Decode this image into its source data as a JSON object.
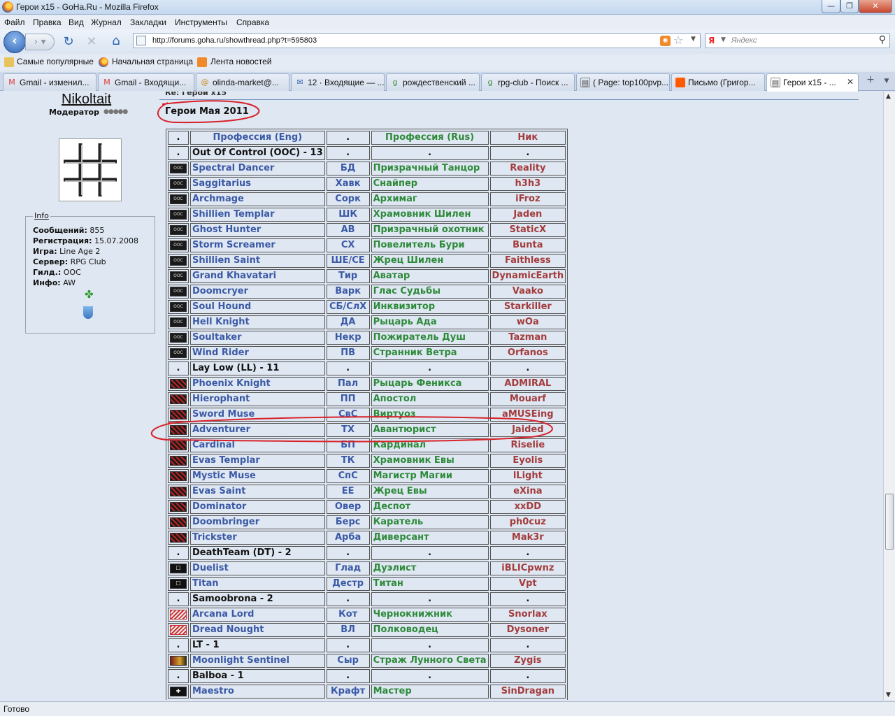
{
  "window": {
    "title": "Герои x15 - GoHa.Ru - Mozilla Firefox",
    "min": "—",
    "max": "❐",
    "close": "✕"
  },
  "menu": [
    "Файл",
    "Правка",
    "Вид",
    "Журнал",
    "Закладки",
    "Инструменты",
    "Справка"
  ],
  "nav": {
    "url": "http://forums.goha.ru/showthread.php?t=595803",
    "search_placeholder": "Яндекс"
  },
  "bookmarks": [
    "Самые популярные",
    "Начальная страница",
    "Лента новостей"
  ],
  "tabs": [
    {
      "label": "Gmail - изменил...",
      "icon": "gmail-icon"
    },
    {
      "label": "Gmail - Входящи...",
      "icon": "gmail-icon"
    },
    {
      "label": "olinda-market@...",
      "icon": "mail-icon"
    },
    {
      "label": "12 · Входящие — ...",
      "icon": "mail-icon"
    },
    {
      "label": "рождественский ...",
      "icon": "google-icon"
    },
    {
      "label": "rpg-club - Поиск ...",
      "icon": "google-icon"
    },
    {
      "label": "( Page: top100pvp...",
      "icon": "page-icon"
    },
    {
      "label": "Письмо (Григор...",
      "icon": "mail-icon"
    },
    {
      "label": "Герои x15 - ...",
      "icon": "page-icon"
    }
  ],
  "sidebar": {
    "username": "Nikoltait",
    "rank": "Модератор",
    "info_title": "Info",
    "info": [
      {
        "k": "Сообщений:",
        "v": "855"
      },
      {
        "k": "Регистрация:",
        "v": "15.07.2008"
      },
      {
        "k": "Игра:",
        "v": "Line Age 2"
      },
      {
        "k": "Сервер:",
        "v": "RPG Club"
      },
      {
        "k": "Гилд.:",
        "v": "OOC"
      },
      {
        "k": "Инфо:",
        "v": "AW"
      }
    ]
  },
  "post": {
    "title_cut": "Re: Герои x15",
    "heading": "Герои Мая 2011"
  },
  "table": {
    "header": {
      "icon": ".",
      "eng": "Профессия (Eng)",
      "short": ".",
      "rus": "Профессия (Rus)",
      "nick": "Ник"
    },
    "rows": [
      {
        "clan": "Out Of Control (OOC) - 13"
      },
      {
        "icon": "ooc",
        "eng": "Spectral Dancer",
        "short": "БД",
        "rus": "Призрачный Танцор",
        "nick": "Reality"
      },
      {
        "icon": "ooc",
        "eng": "Saggitarius",
        "short": "Хавк",
        "rus": "Снайпер",
        "nick": "h3h3"
      },
      {
        "icon": "ooc",
        "eng": "Archmage",
        "short": "Сорк",
        "rus": "Архимаг",
        "nick": "iFroz"
      },
      {
        "icon": "ooc",
        "eng": "Shillien Templar",
        "short": "ШК",
        "rus": "Храмовник Шилен",
        "nick": "Jaden"
      },
      {
        "icon": "ooc",
        "eng": "Ghost Hunter",
        "short": "АВ",
        "rus": "Призрачный охотник",
        "nick": "StaticX"
      },
      {
        "icon": "ooc",
        "eng": "Storm Screamer",
        "short": "СХ",
        "rus": "Повелитель Бури",
        "nick": "Bunta"
      },
      {
        "icon": "ooc",
        "eng": "Shillien Saint",
        "short": "ШЕ/СЕ",
        "rus": "Жрец Шилен",
        "nick": "Faithless"
      },
      {
        "icon": "ooc",
        "eng": "Grand Khavatari",
        "short": "Тир",
        "rus": "Аватар",
        "nick": "DynamicEarth"
      },
      {
        "icon": "ooc",
        "eng": "Doomcryer",
        "short": "Варк",
        "rus": "Глас Судьбы",
        "nick": "Vaako"
      },
      {
        "icon": "ooc",
        "eng": "Soul Hound",
        "short": "СБ/СлХ",
        "rus": "Инквизитор",
        "nick": "Starkiller"
      },
      {
        "icon": "ooc",
        "eng": "Hell Knight",
        "short": "ДА",
        "rus": "Рыцарь Ада",
        "nick": "wOa"
      },
      {
        "icon": "ooc",
        "eng": "Soultaker",
        "short": "Некр",
        "rus": "Пожиратель Душ",
        "nick": "Tazman"
      },
      {
        "icon": "ooc",
        "eng": "Wind Rider",
        "short": "ПВ",
        "rus": "Странник Ветра",
        "nick": "Orfanos"
      },
      {
        "clan": "Lay Low (LL) - 11"
      },
      {
        "icon": "ll",
        "eng": "Phoenix Knight",
        "short": "Пал",
        "rus": "Рыцарь Феникса",
        "nick": "ADMIRAL"
      },
      {
        "icon": "ll",
        "eng": "Hierophant",
        "short": "ПП",
        "rus": "Апостол",
        "nick": "Mouarf"
      },
      {
        "icon": "ll",
        "eng": "Sword Muse",
        "short": "СвС",
        "rus": "Виртуоз",
        "nick": "aMUSEing"
      },
      {
        "icon": "ll",
        "eng": "Adventurer",
        "short": "ТХ",
        "rus": "Авантюрист",
        "nick": "Jaided"
      },
      {
        "icon": "ll",
        "eng": "Cardinal",
        "short": "БП",
        "rus": "Кардинал",
        "nick": "Riselie"
      },
      {
        "icon": "ll",
        "eng": "Evas Templar",
        "short": "ТК",
        "rus": "Храмовник Евы",
        "nick": "Eyolis"
      },
      {
        "icon": "ll",
        "eng": "Mystic Muse",
        "short": "СпС",
        "rus": "Магистр Магии",
        "nick": "lLight"
      },
      {
        "icon": "ll",
        "eng": "Evas Saint",
        "short": "ЕЕ",
        "rus": "Жрец Евы",
        "nick": "eXina"
      },
      {
        "icon": "ll",
        "eng": "Dominator",
        "short": "Овер",
        "rus": "Деспот",
        "nick": "xxDD"
      },
      {
        "icon": "ll",
        "eng": "Doombringer",
        "short": "Берс",
        "rus": "Каратель",
        "nick": "ph0cuz"
      },
      {
        "icon": "ll",
        "eng": "Trickster",
        "short": "Арба",
        "rus": "Диверсант",
        "nick": "Mak3r"
      },
      {
        "clan": "DeathTeam (DT) - 2"
      },
      {
        "icon": "dt",
        "eng": "Duelist",
        "short": "Глад",
        "rus": "Дуэлист",
        "nick": "iBLICpwnz"
      },
      {
        "icon": "dt",
        "eng": "Titan",
        "short": "Дестр",
        "rus": "Титан",
        "nick": "Vpt"
      },
      {
        "clan": "Samoobrona - 2"
      },
      {
        "icon": "sb",
        "eng": "Arcana Lord",
        "short": "Кот",
        "rus": "Чернокнижник",
        "nick": "Snorlax"
      },
      {
        "icon": "sb",
        "eng": "Dread Nought",
        "short": "ВЛ",
        "rus": "Полководец",
        "nick": "Dysoner"
      },
      {
        "clan": "LT - 1"
      },
      {
        "icon": "lt",
        "eng": "Moonlight Sentinel",
        "short": "Сыр",
        "rus": "Страж Лунного Света",
        "nick": "Zygis"
      },
      {
        "clan": "Balboa - 1"
      },
      {
        "icon": "bb",
        "eng": "Maestro",
        "short": "Крафт",
        "rus": "Мастер",
        "nick": "SinDragan"
      }
    ]
  },
  "status": "Готово",
  "colors": {
    "eng": "#3b5aa6",
    "rus": "#2e8a3a",
    "nick": "#a33c3c",
    "annotation": "#d8222a"
  }
}
